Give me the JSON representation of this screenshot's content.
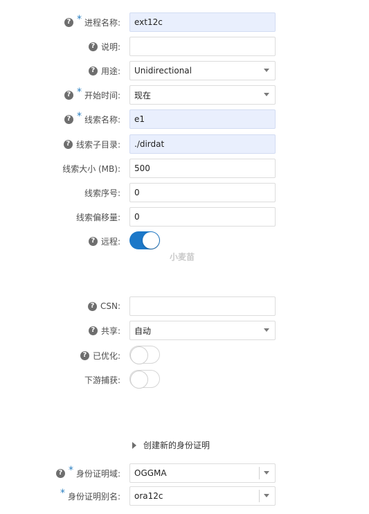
{
  "fields": [
    {
      "label": "进程名称:",
      "help": true,
      "required": true,
      "value": "ext12c",
      "kind": "text",
      "filled": true
    },
    {
      "label": "说明:",
      "help": true,
      "required": false,
      "value": "",
      "kind": "text",
      "filled": false
    },
    {
      "label": "用途:",
      "help": true,
      "required": false,
      "value": "Unidirectional",
      "kind": "select",
      "filled": false
    },
    {
      "label": "开始时间:",
      "help": true,
      "required": true,
      "value": "现在",
      "kind": "select",
      "filled": false
    },
    {
      "label": "线索名称:",
      "help": true,
      "required": true,
      "value": "e1",
      "kind": "text",
      "filled": true
    },
    {
      "label": "线索子目录:",
      "help": true,
      "required": false,
      "value": "./dirdat",
      "kind": "text",
      "filled": true
    },
    {
      "label": "线索大小 (MB):",
      "help": false,
      "required": false,
      "value": "500",
      "kind": "text",
      "filled": false
    },
    {
      "label": "线索序号:",
      "help": false,
      "required": false,
      "value": "0",
      "kind": "text",
      "filled": false
    },
    {
      "label": "线索偏移量:",
      "help": false,
      "required": false,
      "value": "0",
      "kind": "text",
      "filled": false
    },
    {
      "label": "远程:",
      "help": true,
      "required": false,
      "value": "on",
      "kind": "toggle"
    },
    {
      "label": "CSN:",
      "help": true,
      "required": false,
      "value": "",
      "kind": "text",
      "filled": false
    },
    {
      "label": "共享:",
      "help": true,
      "required": false,
      "value": "自动",
      "kind": "select",
      "filled": false
    },
    {
      "label": "已优化:",
      "help": true,
      "required": false,
      "value": "off",
      "kind": "toggle"
    },
    {
      "label": "下游捕获:",
      "help": false,
      "required": false,
      "value": "off",
      "kind": "toggle"
    },
    {
      "label": "身份证明域:",
      "help": true,
      "required": true,
      "value": "OGGMA",
      "kind": "combo",
      "filled": false
    },
    {
      "label": "身份证明别名:",
      "help": false,
      "required": true,
      "value": "ora12c",
      "kind": "combo",
      "filled": false
    }
  ],
  "help_glyph": "?",
  "required_glyph": "*",
  "watermark": "小麦苗",
  "create_credential_label": "创建新的身份证明",
  "colors": {
    "accent": "#1c78c8",
    "filled_bg": "#e9effd",
    "required": "#2a7fc1"
  }
}
